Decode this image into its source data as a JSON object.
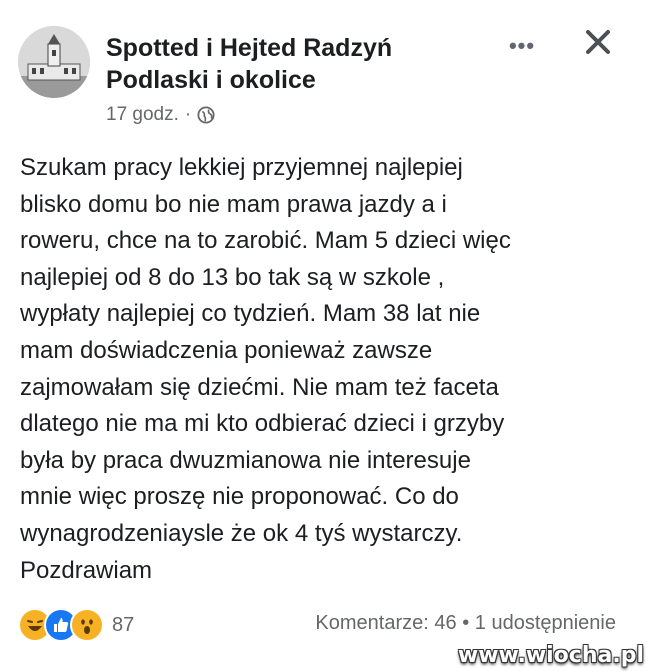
{
  "header": {
    "group_name": "Spotted i Hejted Radzyń Podlaski i okolice",
    "timestamp": "17 godz.",
    "separator": "·",
    "privacy_icon": "globe-icon",
    "more_icon": "more-options-icon",
    "close_icon": "close-icon"
  },
  "post": {
    "lines": [
      "Szukam pracy lekkiej przyjemnej najlepiej",
      "blisko domu bo nie mam prawa jazdy a i",
      "roweru, chce na to zarobić. Mam 5 dzieci więc",
      "najlepiej od 8 do 13 bo tak są w szkole ,",
      "wypłaty najlepiej co tydzień. Mam 38 lat nie",
      "mam doświadczenia ponieważ zawsze",
      "zajmowałam się dziećmi. Nie mam też faceta",
      "dlatego nie ma mi kto odbierać dzieci i grzyby",
      "była by praca dwuzmianowa nie interesuje",
      "mnie więc proszę nie proponować. Co do",
      "wynagrodzeniaysle że ok 4 tyś wystarczy.",
      "Pozdrawiam"
    ]
  },
  "footer": {
    "reaction_icons": [
      "haha-reaction-icon",
      "like-reaction-icon",
      "wow-reaction-icon"
    ],
    "reaction_count": "87",
    "comments": "Komentarze: 46",
    "dot": "•",
    "shares": "1 udostępnienie"
  },
  "watermark": "www.wiocha.pl",
  "colors": {
    "text": "#1c1e21",
    "secondary": "#65676b",
    "like_blue": "#1877f2",
    "haha_yellow": "#f7b125"
  }
}
